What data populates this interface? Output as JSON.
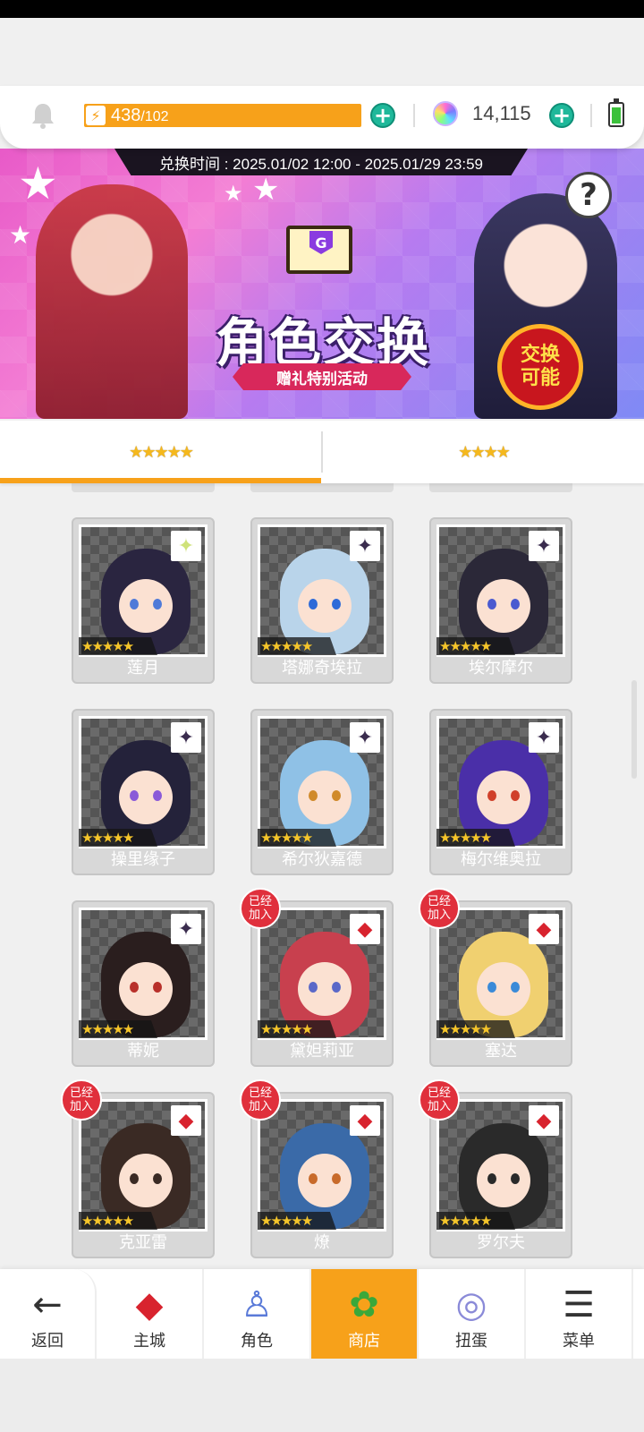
{
  "resources": {
    "energy_current": "438",
    "energy_max": "/102",
    "gems": "14,115",
    "energy_fill_fraction": 1.0
  },
  "banner": {
    "time_label": "兑换时间 : 2025.01/02 12:00 - 2025.01/29 23:59",
    "title": "角色交换",
    "subtitle": "赠礼特别活动",
    "badge_line1": "交换",
    "badge_line2": "可能",
    "help": "?"
  },
  "tabs": [
    {
      "label": "★★★★★",
      "active": true
    },
    {
      "label": "★★★★",
      "active": false
    }
  ],
  "card_stars": "★★★★★",
  "joined_label_line1": "已经",
  "joined_label_line2": "加入",
  "characters": [
    {
      "name": "莲月",
      "corner": "light-sparkle-icon",
      "joined": false,
      "color": "#2a2540",
      "eye": "#4f7ad8"
    },
    {
      "name": "塔娜奇埃拉",
      "corner": "dark-sparkle-icon",
      "joined": false,
      "color": "#b9d4ea",
      "eye": "#2d6ad8"
    },
    {
      "name": "埃尔摩尔",
      "corner": "dark-sparkle-icon",
      "joined": false,
      "color": "#2b2838",
      "eye": "#4a5ad0"
    },
    {
      "name": "操里缘子",
      "corner": "dark-sparkle-icon",
      "joined": false,
      "color": "#24223a",
      "eye": "#8a5ad8"
    },
    {
      "name": "希尔狄嘉德",
      "corner": "dark-sparkle-icon",
      "joined": false,
      "color": "#8fc1e6",
      "eye": "#d08a2a"
    },
    {
      "name": "梅尔维奥拉",
      "corner": "dark-sparkle-icon",
      "joined": false,
      "color": "#4a2fa8",
      "eye": "#d0402a"
    },
    {
      "name": "蒂妮",
      "corner": "dark-sparkle-icon",
      "joined": false,
      "color": "#2a1e1e",
      "eye": "#b8302a"
    },
    {
      "name": "黛妲莉亚",
      "corner": "red-diamond-icon",
      "joined": true,
      "color": "#c8404e",
      "eye": "#5a68c8"
    },
    {
      "name": "塞达",
      "corner": "red-diamond-icon",
      "joined": true,
      "color": "#f0d070",
      "eye": "#3a8ad8"
    },
    {
      "name": "克亚雷",
      "corner": "red-diamond-icon",
      "joined": true,
      "color": "#3a2a24",
      "eye": "#3a2a24"
    },
    {
      "name": "燎",
      "corner": "red-diamond-icon",
      "joined": true,
      "color": "#3a6aa8",
      "eye": "#c86a2a"
    },
    {
      "name": "罗尔夫",
      "corner": "red-diamond-icon",
      "joined": true,
      "color": "#2a2a2a",
      "eye": "#2a2a2a"
    }
  ],
  "nav": [
    {
      "label": "返回",
      "icon": "back-arrow-icon"
    },
    {
      "label": "主城",
      "icon": "castle-icon"
    },
    {
      "label": "角色",
      "icon": "character-icon"
    },
    {
      "label": "商店",
      "icon": "shop-bag-icon",
      "active": true
    },
    {
      "label": "扭蛋",
      "icon": "gacha-capsule-icon"
    },
    {
      "label": "菜单",
      "icon": "menu-list-icon"
    }
  ],
  "colors": {
    "accent": "#f7a11a",
    "plus": "#1fb89a",
    "joined_badge": "#e0303c"
  }
}
